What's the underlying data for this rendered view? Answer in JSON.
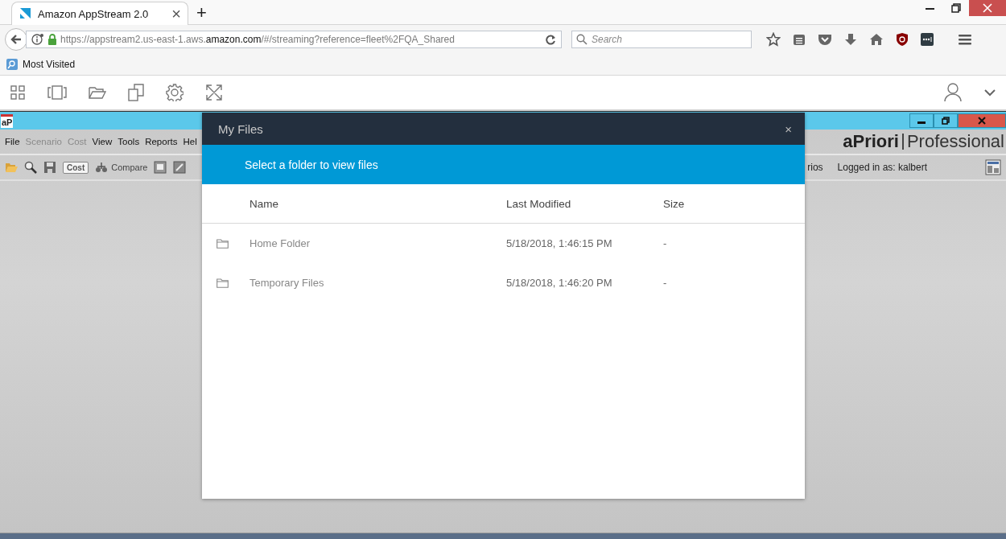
{
  "browser": {
    "tab": {
      "title": "Amazon AppStream 2.0",
      "close": "×",
      "selected": true
    },
    "new_tab": "+",
    "address": "https://appstream2.us-east-1.aws.**amazon.com**/#/streaming?reference=fleet%2FQA_Shared",
    "search": {
      "placeholder": "Search"
    },
    "bookmarks": [
      {
        "label": "Most Visited"
      }
    ]
  },
  "app_window": {
    "logo": "aP",
    "menu": [
      {
        "label": "File",
        "disabled": false
      },
      {
        "label": "Scenario",
        "disabled": true
      },
      {
        "label": "Cost",
        "disabled": true
      },
      {
        "label": "View",
        "disabled": false
      },
      {
        "label": "Tools",
        "disabled": false
      },
      {
        "label": "Reports",
        "disabled": false
      },
      {
        "label": "Hel",
        "disabled": false
      }
    ],
    "brand": {
      "name": "aPriori",
      "edition": "Professional"
    },
    "toolbar": {
      "cost_button": "Cost",
      "compare_button": "Compare",
      "cut_label": "rios",
      "user": "Logged in as: kalbert"
    }
  },
  "dialog": {
    "title": "My Files",
    "close": "×",
    "banner": "Select a folder to view files",
    "columns": [
      "Name",
      "Last Modified",
      "Size"
    ],
    "rows": [
      {
        "name": "Home Folder",
        "modified": "5/18/2018, 1:46:15 PM",
        "size": "-"
      },
      {
        "name": "Temporary Files",
        "modified": "5/18/2018, 1:46:20 PM",
        "size": "-"
      }
    ]
  }
}
